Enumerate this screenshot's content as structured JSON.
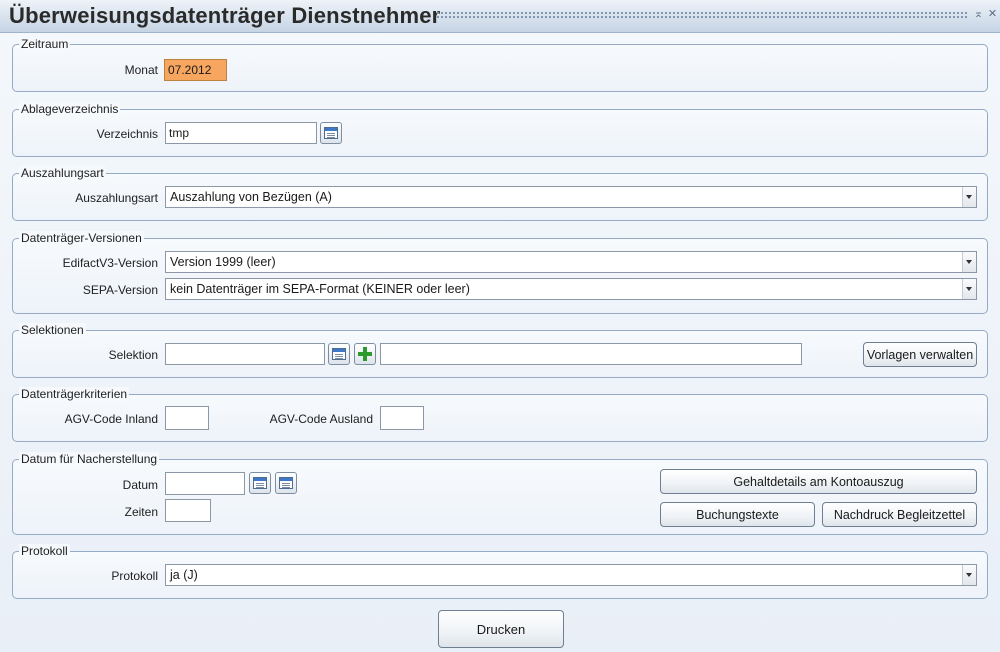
{
  "window": {
    "title": "Überweisungsdatenträger Dienstnehmer",
    "minimize_glyph": "⌅",
    "close_glyph": "✕"
  },
  "zeitraum": {
    "legend": "Zeitraum",
    "monat_label": "Monat",
    "monat_value": "07.2012"
  },
  "ablage": {
    "legend": "Ablageverzeichnis",
    "verzeichnis_label": "Verzeichnis",
    "verzeichnis_value": "tmp",
    "browse_icon": "folder-browse-icon"
  },
  "auszahlungsart": {
    "legend": "Auszahlungsart",
    "label": "Auszahlungsart",
    "selected": "Auszahlung von Bezügen (A)"
  },
  "versionen": {
    "legend": "Datenträger-Versionen",
    "edifact_label": "EdifactV3-Version",
    "edifact_selected": "Version 1999 (leer)",
    "sepa_label": "SEPA-Version",
    "sepa_selected": "kein Datenträger im SEPA-Format (KEINER oder leer)"
  },
  "selektionen": {
    "legend": "Selektionen",
    "label": "Selektion",
    "value": "",
    "description": "",
    "vorlagen_button": "Vorlagen verwalten"
  },
  "kriterien": {
    "legend": "Datenträgerkriterien",
    "inland_label": "AGV-Code Inland",
    "inland_value": "",
    "ausland_label": "AGV-Code Ausland",
    "ausland_value": ""
  },
  "nacherstellung": {
    "legend": "Datum für Nacherstellung",
    "datum_label": "Datum",
    "datum_value": "",
    "zeiten_label": "Zeiten",
    "zeiten_value": "",
    "gehaltdetails_button": "Gehaltdetails am Kontoauszug",
    "buchungstexte_button": "Buchungstexte",
    "nachdruck_button": "Nachdruck Begleitzettel"
  },
  "protokoll": {
    "legend": "Protokoll",
    "label": "Protokoll",
    "selected": "ja (J)"
  },
  "footer": {
    "print_button": "Drucken"
  }
}
